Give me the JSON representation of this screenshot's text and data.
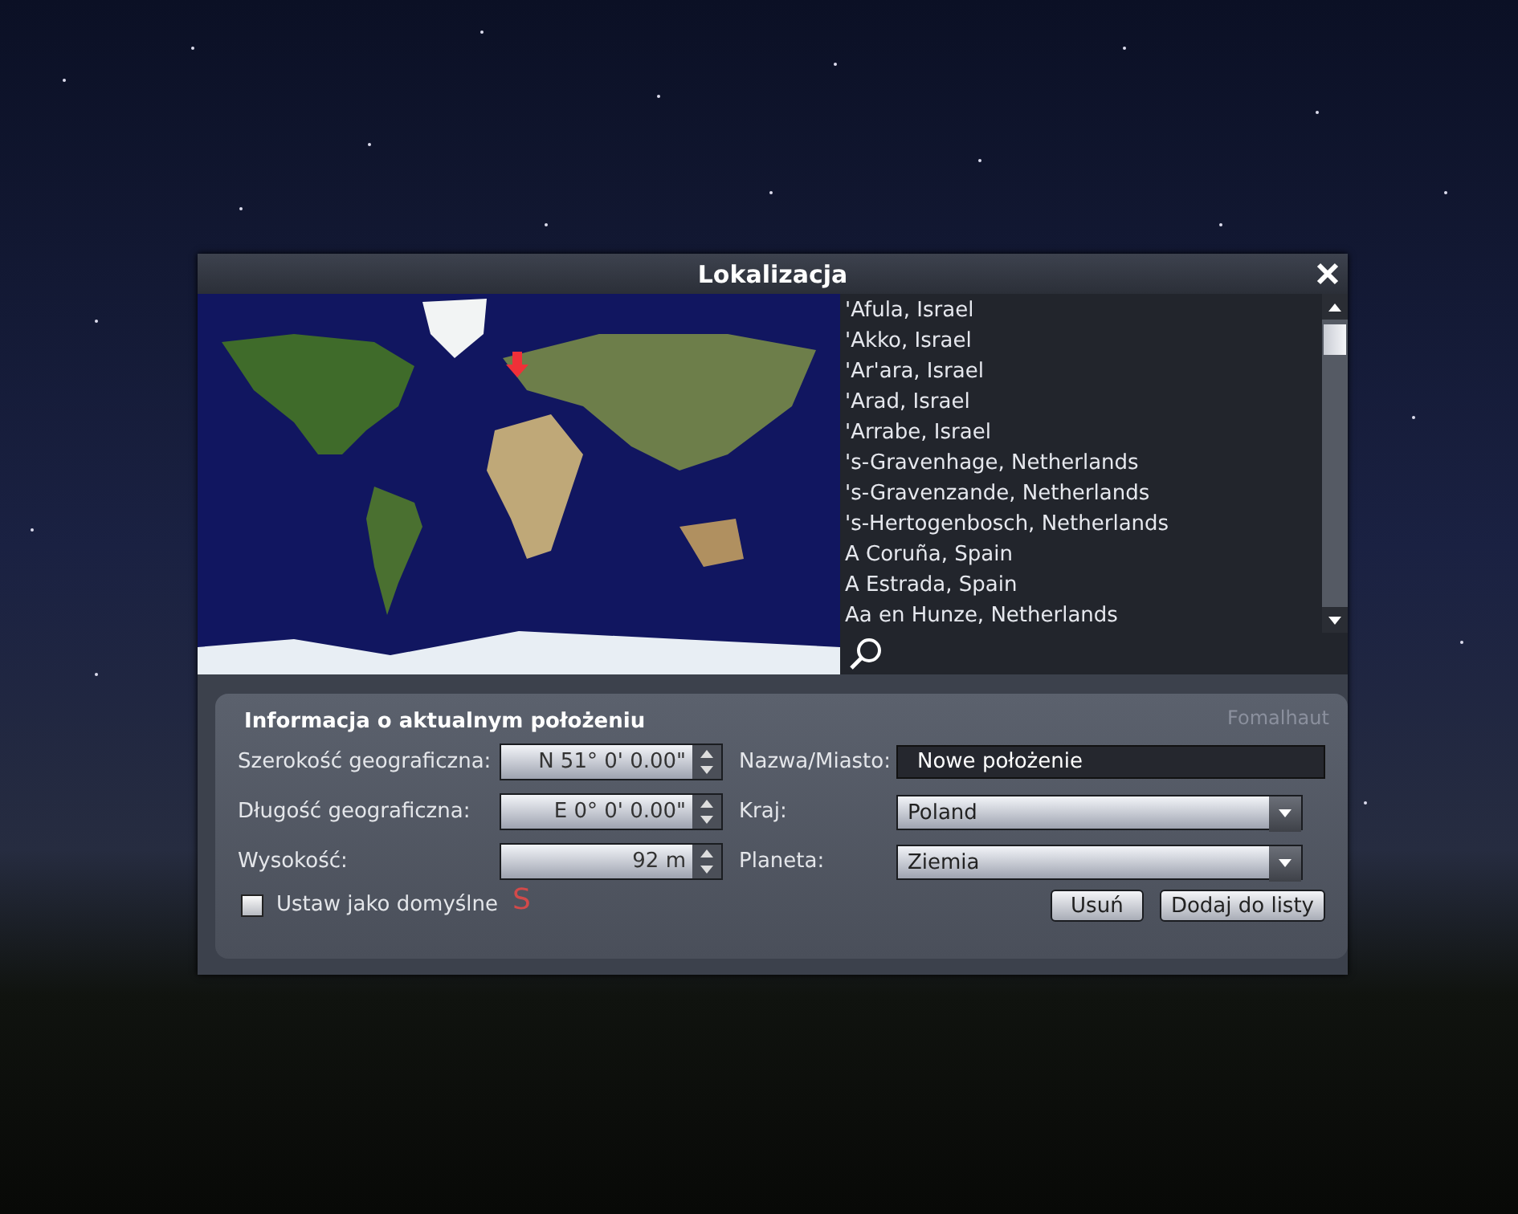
{
  "window": {
    "title": "Lokalizacja"
  },
  "city_list": {
    "items": [
      "'Afula, Israel",
      "'Akko, Israel",
      "'Ar'ara, Israel",
      "'Arad, Israel",
      "'Arrabe, Israel",
      "'s-Gravenhage, Netherlands",
      "'s-Gravenzande, Netherlands",
      "'s-Hertogenbosch, Netherlands",
      "A Coruña, Spain",
      "A Estrada, Spain",
      "Aa en Hunze, Netherlands"
    ]
  },
  "location_info": {
    "heading": "Informacja o aktualnym położeniu",
    "coordinates": [
      {
        "label": "Szerokość geograficzna:",
        "value": "N 51° 0' 0.00\""
      },
      {
        "label": "Długość geograficzna:",
        "value": "E 0° 0' 0.00\""
      },
      {
        "label": "Wysokość:",
        "value": "92 m"
      }
    ],
    "name": {
      "label": "Nazwa/Miasto:",
      "value": "Nowe położenie"
    },
    "selects": [
      {
        "label": "Kraj:",
        "value": "Poland"
      },
      {
        "label": "Planeta:",
        "value": "Ziemia"
      }
    ],
    "default_checkbox": {
      "label": "Ustaw jako domyślne",
      "checked": false
    },
    "buttons": [
      "Usuń",
      "Dodaj do listy"
    ]
  },
  "sky_labels": [
    {
      "kind": "star",
      "text": "Fomalhaut"
    },
    {
      "kind": "compass",
      "text": "S"
    }
  ]
}
